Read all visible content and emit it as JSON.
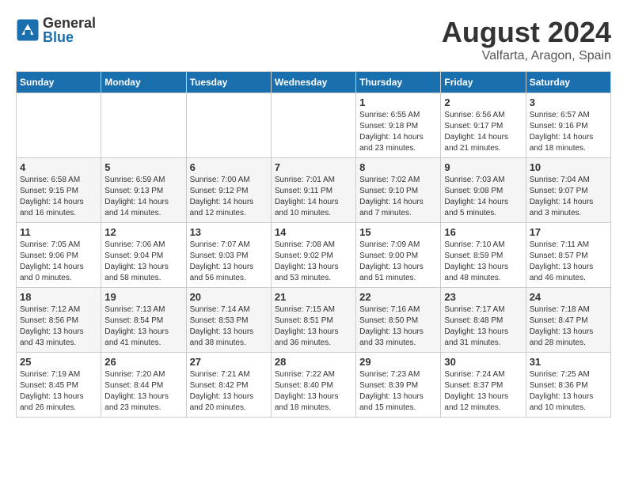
{
  "header": {
    "logo_general": "General",
    "logo_blue": "Blue",
    "title": "August 2024",
    "subtitle": "Valfarta, Aragon, Spain"
  },
  "days_of_week": [
    "Sunday",
    "Monday",
    "Tuesday",
    "Wednesday",
    "Thursday",
    "Friday",
    "Saturday"
  ],
  "weeks": [
    [
      {
        "num": "",
        "info": ""
      },
      {
        "num": "",
        "info": ""
      },
      {
        "num": "",
        "info": ""
      },
      {
        "num": "",
        "info": ""
      },
      {
        "num": "1",
        "info": "Sunrise: 6:55 AM\nSunset: 9:18 PM\nDaylight: 14 hours\nand 23 minutes."
      },
      {
        "num": "2",
        "info": "Sunrise: 6:56 AM\nSunset: 9:17 PM\nDaylight: 14 hours\nand 21 minutes."
      },
      {
        "num": "3",
        "info": "Sunrise: 6:57 AM\nSunset: 9:16 PM\nDaylight: 14 hours\nand 18 minutes."
      }
    ],
    [
      {
        "num": "4",
        "info": "Sunrise: 6:58 AM\nSunset: 9:15 PM\nDaylight: 14 hours\nand 16 minutes."
      },
      {
        "num": "5",
        "info": "Sunrise: 6:59 AM\nSunset: 9:13 PM\nDaylight: 14 hours\nand 14 minutes."
      },
      {
        "num": "6",
        "info": "Sunrise: 7:00 AM\nSunset: 9:12 PM\nDaylight: 14 hours\nand 12 minutes."
      },
      {
        "num": "7",
        "info": "Sunrise: 7:01 AM\nSunset: 9:11 PM\nDaylight: 14 hours\nand 10 minutes."
      },
      {
        "num": "8",
        "info": "Sunrise: 7:02 AM\nSunset: 9:10 PM\nDaylight: 14 hours\nand 7 minutes."
      },
      {
        "num": "9",
        "info": "Sunrise: 7:03 AM\nSunset: 9:08 PM\nDaylight: 14 hours\nand 5 minutes."
      },
      {
        "num": "10",
        "info": "Sunrise: 7:04 AM\nSunset: 9:07 PM\nDaylight: 14 hours\nand 3 minutes."
      }
    ],
    [
      {
        "num": "11",
        "info": "Sunrise: 7:05 AM\nSunset: 9:06 PM\nDaylight: 14 hours\nand 0 minutes."
      },
      {
        "num": "12",
        "info": "Sunrise: 7:06 AM\nSunset: 9:04 PM\nDaylight: 13 hours\nand 58 minutes."
      },
      {
        "num": "13",
        "info": "Sunrise: 7:07 AM\nSunset: 9:03 PM\nDaylight: 13 hours\nand 56 minutes."
      },
      {
        "num": "14",
        "info": "Sunrise: 7:08 AM\nSunset: 9:02 PM\nDaylight: 13 hours\nand 53 minutes."
      },
      {
        "num": "15",
        "info": "Sunrise: 7:09 AM\nSunset: 9:00 PM\nDaylight: 13 hours\nand 51 minutes."
      },
      {
        "num": "16",
        "info": "Sunrise: 7:10 AM\nSunset: 8:59 PM\nDaylight: 13 hours\nand 48 minutes."
      },
      {
        "num": "17",
        "info": "Sunrise: 7:11 AM\nSunset: 8:57 PM\nDaylight: 13 hours\nand 46 minutes."
      }
    ],
    [
      {
        "num": "18",
        "info": "Sunrise: 7:12 AM\nSunset: 8:56 PM\nDaylight: 13 hours\nand 43 minutes."
      },
      {
        "num": "19",
        "info": "Sunrise: 7:13 AM\nSunset: 8:54 PM\nDaylight: 13 hours\nand 41 minutes."
      },
      {
        "num": "20",
        "info": "Sunrise: 7:14 AM\nSunset: 8:53 PM\nDaylight: 13 hours\nand 38 minutes."
      },
      {
        "num": "21",
        "info": "Sunrise: 7:15 AM\nSunset: 8:51 PM\nDaylight: 13 hours\nand 36 minutes."
      },
      {
        "num": "22",
        "info": "Sunrise: 7:16 AM\nSunset: 8:50 PM\nDaylight: 13 hours\nand 33 minutes."
      },
      {
        "num": "23",
        "info": "Sunrise: 7:17 AM\nSunset: 8:48 PM\nDaylight: 13 hours\nand 31 minutes."
      },
      {
        "num": "24",
        "info": "Sunrise: 7:18 AM\nSunset: 8:47 PM\nDaylight: 13 hours\nand 28 minutes."
      }
    ],
    [
      {
        "num": "25",
        "info": "Sunrise: 7:19 AM\nSunset: 8:45 PM\nDaylight: 13 hours\nand 26 minutes."
      },
      {
        "num": "26",
        "info": "Sunrise: 7:20 AM\nSunset: 8:44 PM\nDaylight: 13 hours\nand 23 minutes."
      },
      {
        "num": "27",
        "info": "Sunrise: 7:21 AM\nSunset: 8:42 PM\nDaylight: 13 hours\nand 20 minutes."
      },
      {
        "num": "28",
        "info": "Sunrise: 7:22 AM\nSunset: 8:40 PM\nDaylight: 13 hours\nand 18 minutes."
      },
      {
        "num": "29",
        "info": "Sunrise: 7:23 AM\nSunset: 8:39 PM\nDaylight: 13 hours\nand 15 minutes."
      },
      {
        "num": "30",
        "info": "Sunrise: 7:24 AM\nSunset: 8:37 PM\nDaylight: 13 hours\nand 12 minutes."
      },
      {
        "num": "31",
        "info": "Sunrise: 7:25 AM\nSunset: 8:36 PM\nDaylight: 13 hours\nand 10 minutes."
      }
    ]
  ]
}
